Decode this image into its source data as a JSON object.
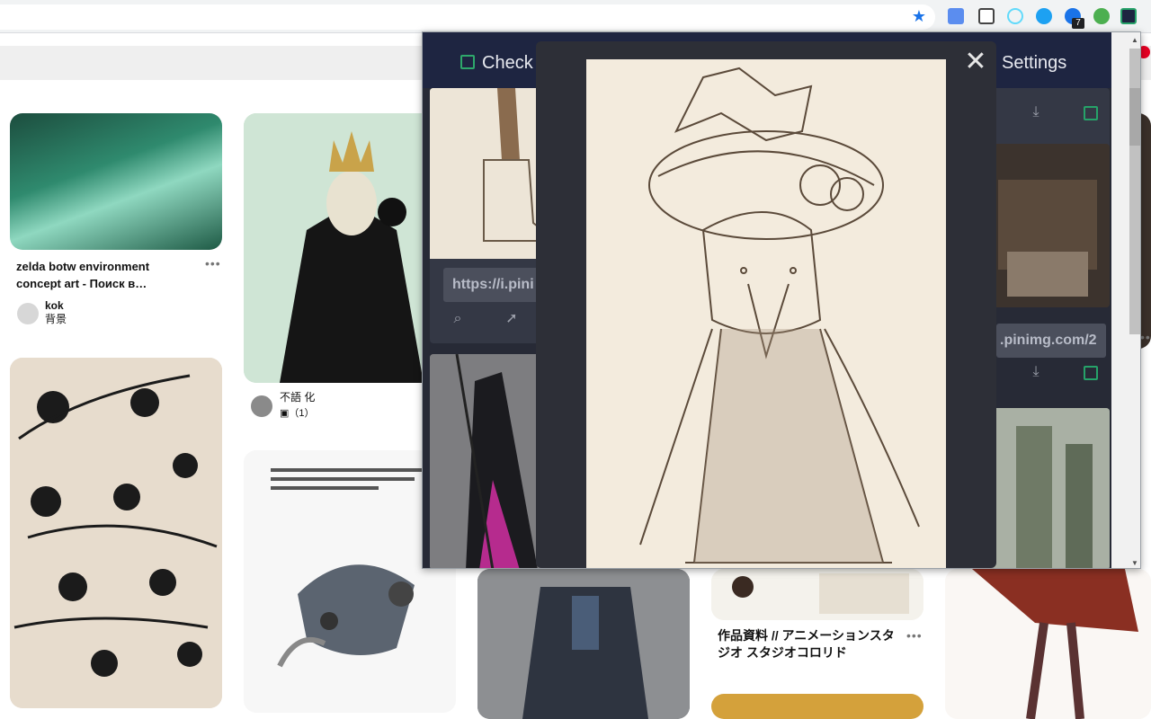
{
  "browser": {
    "badge_count": "7"
  },
  "pins": [
    {
      "title_line1": "zelda botw environment",
      "title_line2": "concept art - Поиск в…",
      "author": "kok",
      "board": "背景"
    },
    {
      "author": "不語 化",
      "board": "▣（1）"
    },
    {
      "title_line1": "作品資料 // アニメーションスタ",
      "title_line2": "ジオ スタジオコロリド"
    }
  ],
  "popup": {
    "header": {
      "check_label": "Check",
      "settings_label": "Settings"
    },
    "url_left": "https://i.pini",
    "url_right": ".pinimg.com/2"
  },
  "colors": {
    "header_bg": "#1e2541",
    "body_bg": "#272a36",
    "accent_green": "#2ea86b",
    "star_blue": "#1a73e8"
  },
  "icons": {
    "close": "close-icon",
    "zoom": "zoom-in-icon",
    "open": "open-external-icon",
    "download": "download-icon"
  }
}
